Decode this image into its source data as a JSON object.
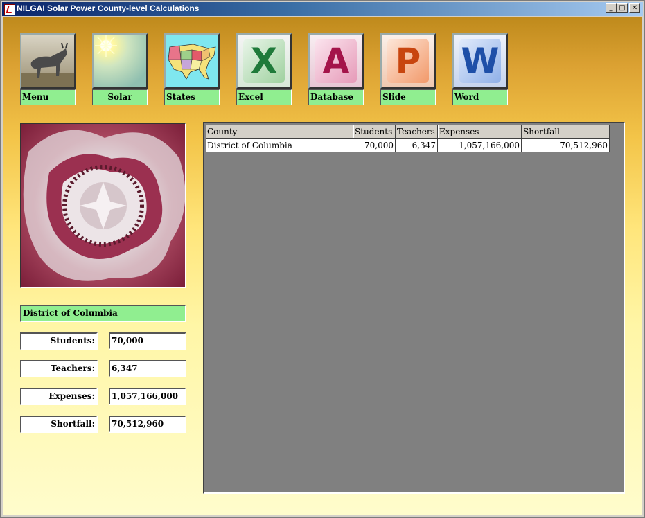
{
  "window": {
    "title": "NILGAI Solar Power County-level Calculations",
    "minimize": "_",
    "maximize": "□",
    "close": "✕"
  },
  "toolbar": [
    {
      "label": "Menu",
      "icon": "nilgai-antelope-icon"
    },
    {
      "label": "Solar",
      "icon": "sun-icon"
    },
    {
      "label": "States",
      "icon": "us-states-map-icon"
    },
    {
      "label": "Excel",
      "icon": "excel-icon",
      "letter": "X",
      "color": "#1f7a3a"
    },
    {
      "label": "Database",
      "icon": "access-database-icon",
      "letter": "A",
      "color": "#a4144a"
    },
    {
      "label": "Slide",
      "icon": "powerpoint-icon",
      "letter": "P",
      "color": "#c8450f"
    },
    {
      "label": "Word",
      "icon": "word-icon",
      "letter": "W",
      "color": "#1e4fa8"
    }
  ],
  "details": {
    "county": "District of Columbia",
    "fields": [
      {
        "label": "Students:",
        "value": "70,000"
      },
      {
        "label": "Teachers:",
        "value": "6,347"
      },
      {
        "label": "Expenses:",
        "value": "1,057,166,000"
      },
      {
        "label": "Shortfall:",
        "value": "70,512,960"
      }
    ]
  },
  "grid": {
    "columns": [
      "County",
      "Students",
      "Teachers",
      "Expenses",
      "Shortfall"
    ],
    "rows": [
      [
        "District of Columbia",
        "70,000",
        "6,347",
        "1,057,166,000",
        "70,512,960"
      ]
    ]
  }
}
